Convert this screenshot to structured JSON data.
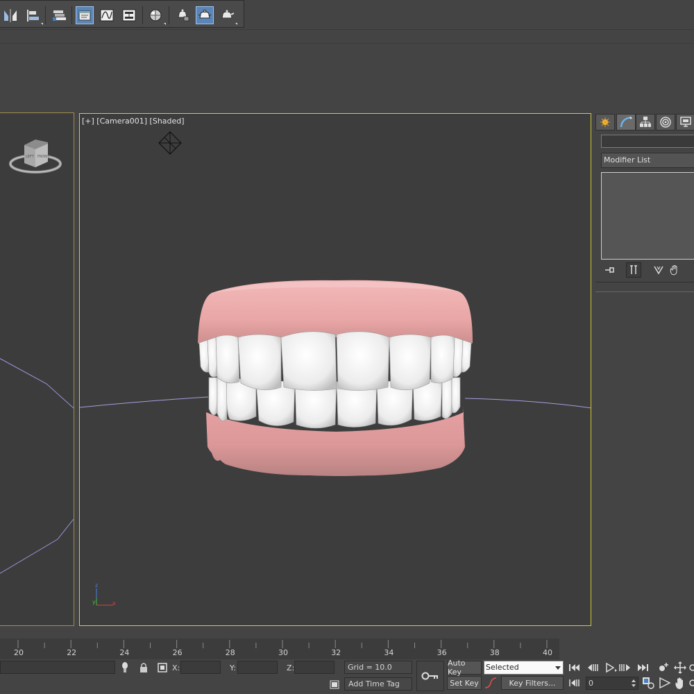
{
  "toolbar": {
    "buttons": [
      {
        "icon": "mirror-icon"
      },
      {
        "icon": "align-icon"
      },
      {
        "icon": "layer-manager-icon"
      },
      {
        "icon": "scene-explorer-icon",
        "active": true
      },
      {
        "icon": "curve-editor-icon"
      },
      {
        "icon": "schematic-view-icon"
      },
      {
        "icon": "material-editor-icon"
      },
      {
        "icon": "render-setup-icon"
      },
      {
        "icon": "rendered-frame-window-icon",
        "active": true
      },
      {
        "icon": "render-production-icon"
      }
    ]
  },
  "viewport_main": {
    "label": "[+] [Camera001] [Shaded]",
    "axis_tripod": {
      "z": "z",
      "y": "y",
      "x": "x"
    }
  },
  "viewport_left": {
    "viewcube": {
      "face_left": "LEFT",
      "face_front": "FRONT"
    }
  },
  "command_panel": {
    "tabs": [
      "create-tab-icon",
      "modify-tab-icon",
      "hierarchy-tab-icon",
      "motion-tab-icon",
      "display-tab-icon"
    ],
    "active_tab": 1,
    "object_name": "",
    "modifier_list": "Modifier List",
    "stack_buttons": [
      "pin-stack-icon",
      "show-end-result-icon",
      "make-unique-icon",
      "remove-modifier-icon"
    ]
  },
  "timeline": {
    "labels": [
      "20",
      "22",
      "24",
      "26",
      "28",
      "30",
      "32",
      "34",
      "36",
      "38",
      "40"
    ]
  },
  "status_bar": {
    "x_label": "X:",
    "y_label": "Y:",
    "z_label": "Z:",
    "x_value": "",
    "y_value": "",
    "z_value": "",
    "grid": "Grid = 10.0",
    "add_time_tag": "Add Time Tag",
    "auto_key": "Auto Key",
    "set_key": "Set Key",
    "selected": "Selected",
    "key_filters": "Key Filters...",
    "current_frame": "0"
  },
  "colors": {
    "active_viewport_border": "#d4cb3a",
    "accent_blue": "#5b85b8",
    "gums": "#e8a8a8",
    "teeth": "#f2f2f2"
  }
}
